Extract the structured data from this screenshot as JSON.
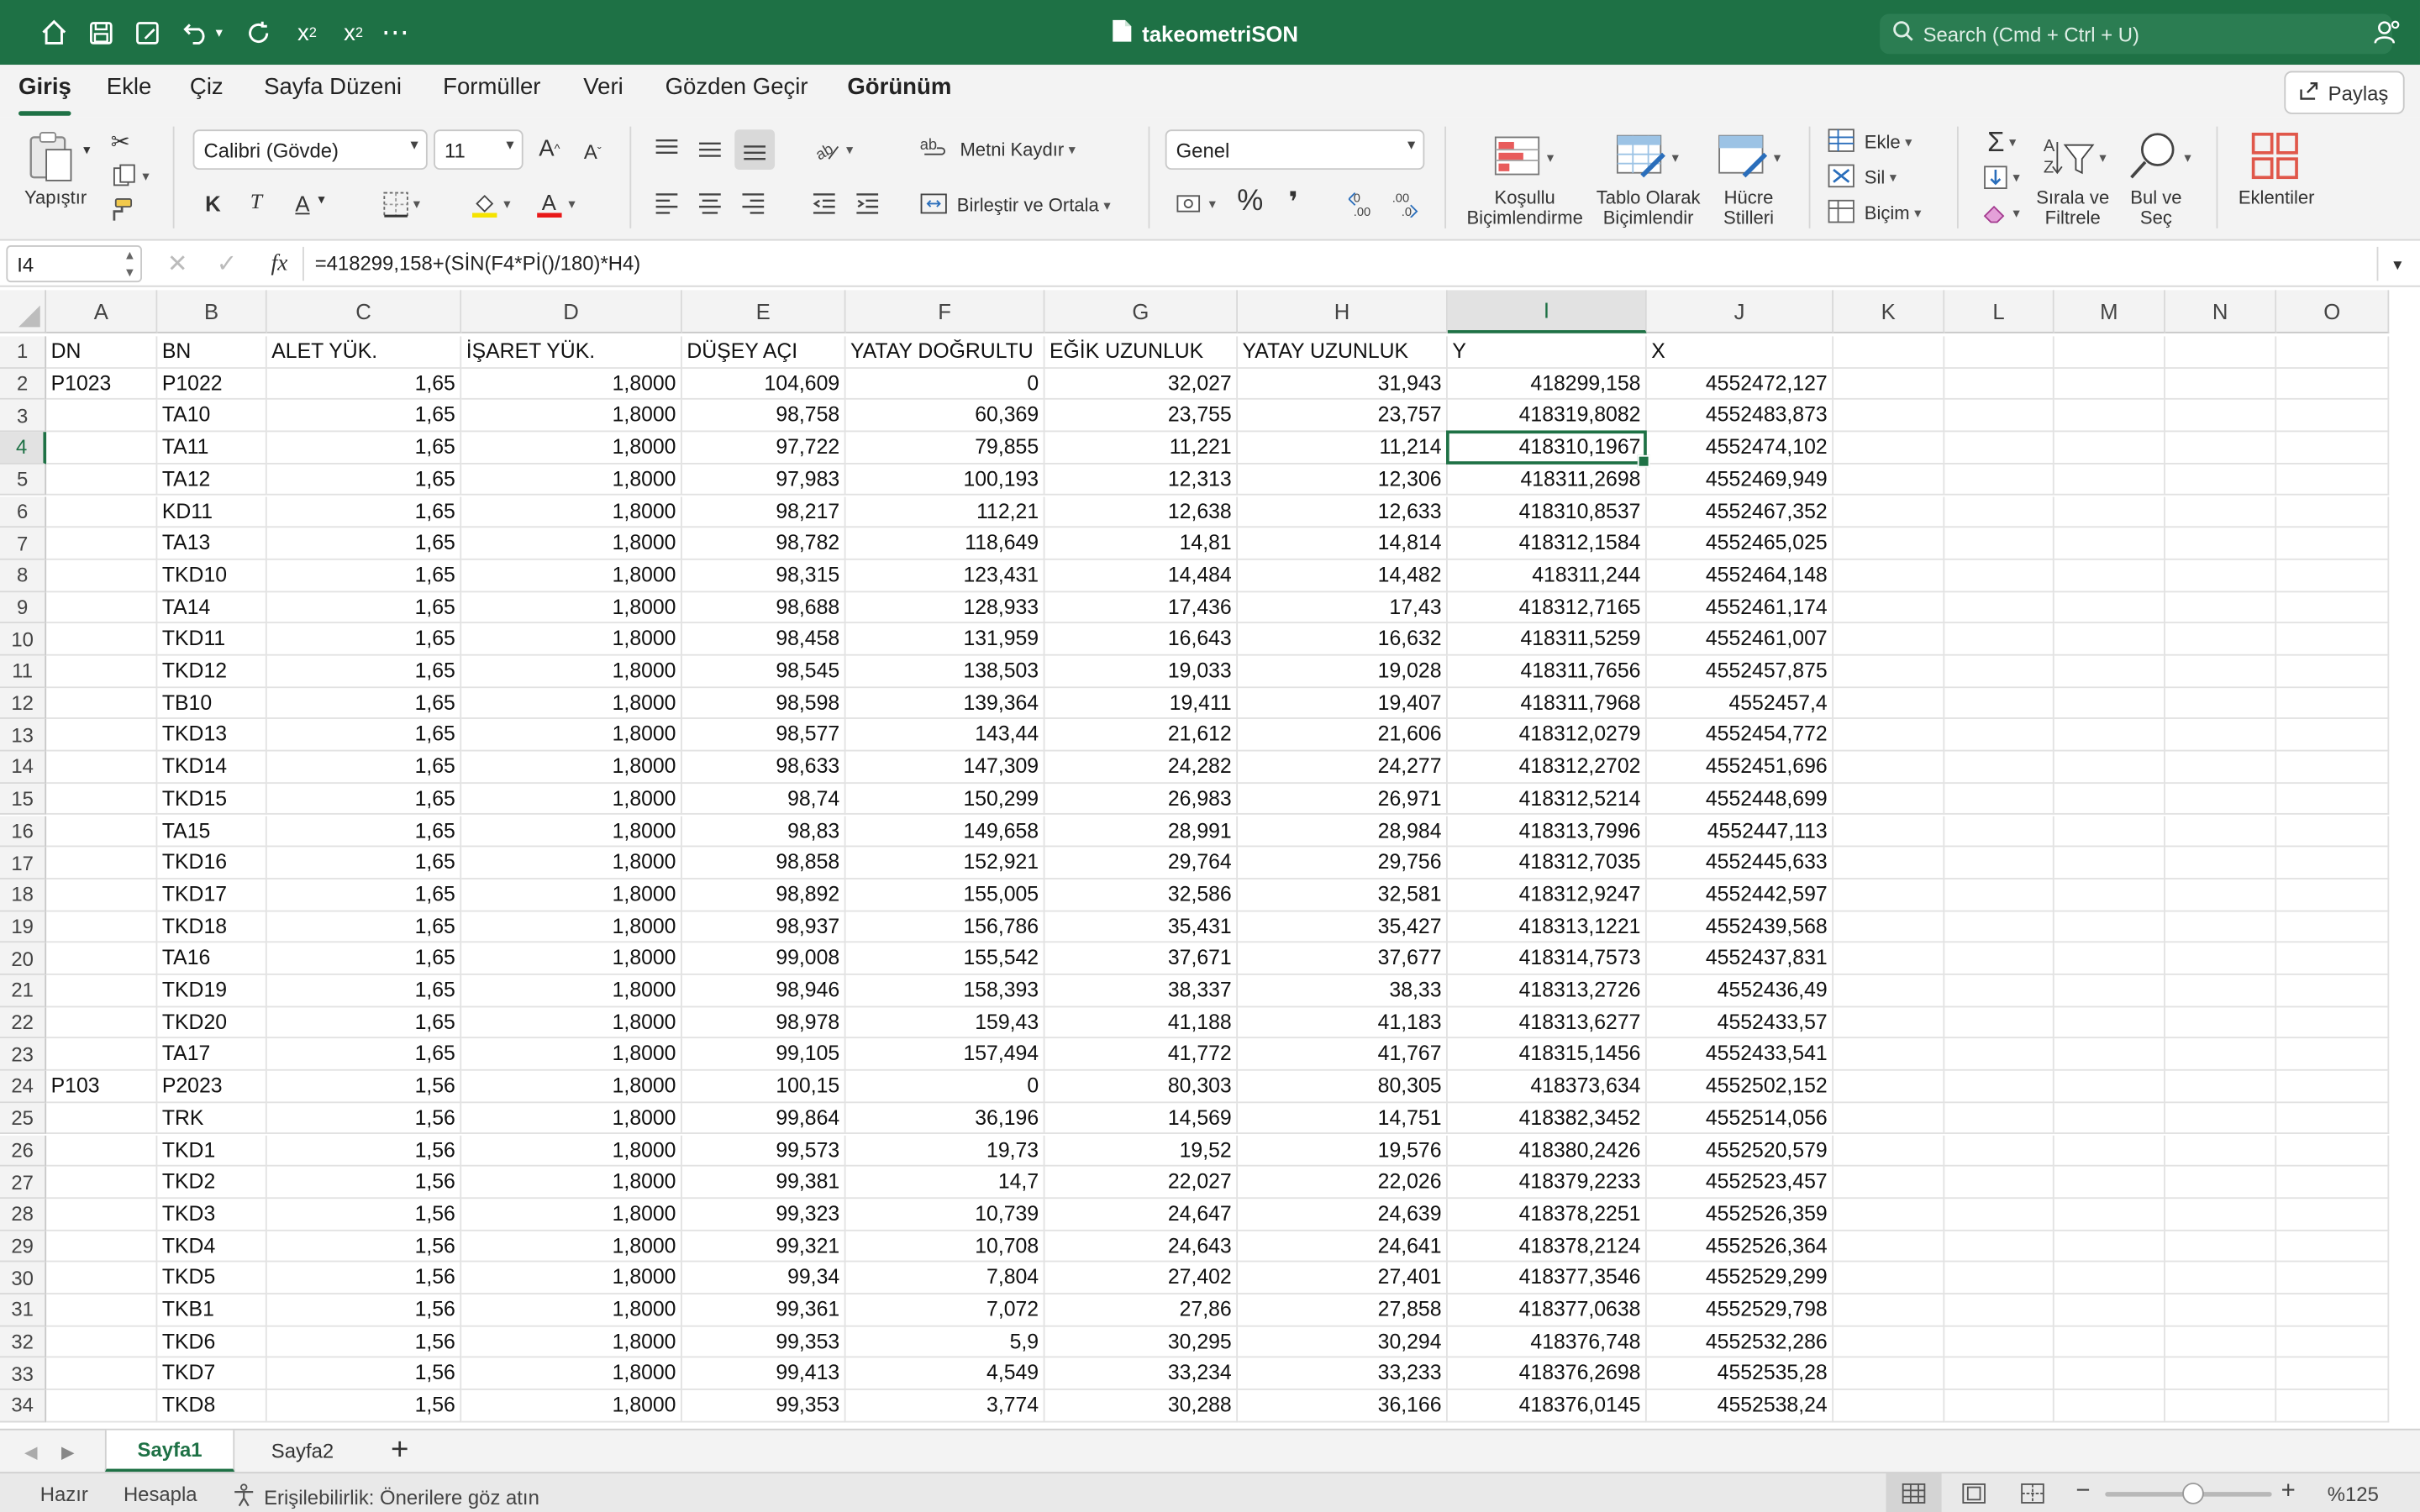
{
  "titlebar": {
    "title": "takeometriSON",
    "search_placeholder": "Search (Cmd + Ctrl + U)"
  },
  "ribbon_tabs": [
    "Giriş",
    "Ekle",
    "Çiz",
    "Sayfa Düzeni",
    "Formüller",
    "Veri",
    "Gözden Geçir",
    "Görünüm"
  ],
  "share_label": "Paylaş",
  "ribbon": {
    "paste_label": "Yapıştır",
    "font_name": "Calibri (Gövde)",
    "font_size": "11",
    "bold": "K",
    "italic": "T",
    "underline": "A",
    "wrap_text": "Metni Kaydır",
    "merge_center": "Birleştir ve Ortala",
    "number_format": "Genel",
    "cond_format": [
      "Koşullu",
      "Biçimlendirme"
    ],
    "format_table": [
      "Tablo Olarak",
      "Biçimlendir"
    ],
    "cell_styles": [
      "Hücre",
      "Stilleri"
    ],
    "insert": "Ekle",
    "delete": "Sil",
    "format": "Biçim",
    "sort_filter": [
      "Sırala ve",
      "Filtrele"
    ],
    "find_select": [
      "Bul ve",
      "Seç"
    ],
    "addins": "Eklentiler",
    "percent": "%",
    "comma": "❜"
  },
  "formula_bar": {
    "name_box": "I4",
    "fx": "fx",
    "formula": "=418299,158+(SİN(F4*Pİ()/180)*H4)"
  },
  "columns": [
    "A",
    "B",
    "C",
    "D",
    "E",
    "F",
    "G",
    "H",
    "I",
    "J",
    "K",
    "L",
    "M",
    "N",
    "O"
  ],
  "selected_cell": {
    "col": "I",
    "row": 4
  },
  "rows": [
    [
      "DN",
      "BN",
      "ALET YÜK.",
      "İŞARET YÜK.",
      "DÜŞEY AÇI",
      "YATAY DOĞRULTU",
      "EĞİK UZUNLUK",
      "YATAY UZUNLUK",
      "Y",
      "X"
    ],
    [
      "P1023",
      "P1022",
      "1,65",
      "1,8000",
      "104,609",
      "0",
      "32,027",
      "31,943",
      "418299,158",
      "4552472,127"
    ],
    [
      "",
      "TA10",
      "1,65",
      "1,8000",
      "98,758",
      "60,369",
      "23,755",
      "23,757",
      "418319,8082",
      "4552483,873"
    ],
    [
      "",
      "TA11",
      "1,65",
      "1,8000",
      "97,722",
      "79,855",
      "11,221",
      "11,214",
      "418310,1967",
      "4552474,102"
    ],
    [
      "",
      "TA12",
      "1,65",
      "1,8000",
      "97,983",
      "100,193",
      "12,313",
      "12,306",
      "418311,2698",
      "4552469,949"
    ],
    [
      "",
      "KD11",
      "1,65",
      "1,8000",
      "98,217",
      "112,21",
      "12,638",
      "12,633",
      "418310,8537",
      "4552467,352"
    ],
    [
      "",
      "TA13",
      "1,65",
      "1,8000",
      "98,782",
      "118,649",
      "14,81",
      "14,814",
      "418312,1584",
      "4552465,025"
    ],
    [
      "",
      "TKD10",
      "1,65",
      "1,8000",
      "98,315",
      "123,431",
      "14,484",
      "14,482",
      "418311,244",
      "4552464,148"
    ],
    [
      "",
      "TA14",
      "1,65",
      "1,8000",
      "98,688",
      "128,933",
      "17,436",
      "17,43",
      "418312,7165",
      "4552461,174"
    ],
    [
      "",
      "TKD11",
      "1,65",
      "1,8000",
      "98,458",
      "131,959",
      "16,643",
      "16,632",
      "418311,5259",
      "4552461,007"
    ],
    [
      "",
      "TKD12",
      "1,65",
      "1,8000",
      "98,545",
      "138,503",
      "19,033",
      "19,028",
      "418311,7656",
      "4552457,875"
    ],
    [
      "",
      "TB10",
      "1,65",
      "1,8000",
      "98,598",
      "139,364",
      "19,411",
      "19,407",
      "418311,7968",
      "4552457,4"
    ],
    [
      "",
      "TKD13",
      "1,65",
      "1,8000",
      "98,577",
      "143,44",
      "21,612",
      "21,606",
      "418312,0279",
      "4552454,772"
    ],
    [
      "",
      "TKD14",
      "1,65",
      "1,8000",
      "98,633",
      "147,309",
      "24,282",
      "24,277",
      "418312,2702",
      "4552451,696"
    ],
    [
      "",
      "TKD15",
      "1,65",
      "1,8000",
      "98,74",
      "150,299",
      "26,983",
      "26,971",
      "418312,5214",
      "4552448,699"
    ],
    [
      "",
      "TA15",
      "1,65",
      "1,8000",
      "98,83",
      "149,658",
      "28,991",
      "28,984",
      "418313,7996",
      "4552447,113"
    ],
    [
      "",
      "TKD16",
      "1,65",
      "1,8000",
      "98,858",
      "152,921",
      "29,764",
      "29,756",
      "418312,7035",
      "4552445,633"
    ],
    [
      "",
      "TKD17",
      "1,65",
      "1,8000",
      "98,892",
      "155,005",
      "32,586",
      "32,581",
      "418312,9247",
      "4552442,597"
    ],
    [
      "",
      "TKD18",
      "1,65",
      "1,8000",
      "98,937",
      "156,786",
      "35,431",
      "35,427",
      "418313,1221",
      "4552439,568"
    ],
    [
      "",
      "TA16",
      "1,65",
      "1,8000",
      "99,008",
      "155,542",
      "37,671",
      "37,677",
      "418314,7573",
      "4552437,831"
    ],
    [
      "",
      "TKD19",
      "1,65",
      "1,8000",
      "98,946",
      "158,393",
      "38,337",
      "38,33",
      "418313,2726",
      "4552436,49"
    ],
    [
      "",
      "TKD20",
      "1,65",
      "1,8000",
      "98,978",
      "159,43",
      "41,188",
      "41,183",
      "418313,6277",
      "4552433,57"
    ],
    [
      "",
      "TA17",
      "1,65",
      "1,8000",
      "99,105",
      "157,494",
      "41,772",
      "41,767",
      "418315,1456",
      "4552433,541"
    ],
    [
      "P103",
      "P2023",
      "1,56",
      "1,8000",
      "100,15",
      "0",
      "80,303",
      "80,305",
      "418373,634",
      "4552502,152"
    ],
    [
      "",
      "TRK",
      "1,56",
      "1,8000",
      "99,864",
      "36,196",
      "14,569",
      "14,751",
      "418382,3452",
      "4552514,056"
    ],
    [
      "",
      "TKD1",
      "1,56",
      "1,8000",
      "99,573",
      "19,73",
      "19,52",
      "19,576",
      "418380,2426",
      "4552520,579"
    ],
    [
      "",
      "TKD2",
      "1,56",
      "1,8000",
      "99,381",
      "14,7",
      "22,027",
      "22,026",
      "418379,2233",
      "4552523,457"
    ],
    [
      "",
      "TKD3",
      "1,56",
      "1,8000",
      "99,323",
      "10,739",
      "24,647",
      "24,639",
      "418378,2251",
      "4552526,359"
    ],
    [
      "",
      "TKD4",
      "1,56",
      "1,8000",
      "99,321",
      "10,708",
      "24,643",
      "24,641",
      "418378,2124",
      "4552526,364"
    ],
    [
      "",
      "TKD5",
      "1,56",
      "1,8000",
      "99,34",
      "7,804",
      "27,402",
      "27,401",
      "418377,3546",
      "4552529,299"
    ],
    [
      "",
      "TKB1",
      "1,56",
      "1,8000",
      "99,361",
      "7,072",
      "27,86",
      "27,858",
      "418377,0638",
      "4552529,798"
    ],
    [
      "",
      "TKD6",
      "1,56",
      "1,8000",
      "99,353",
      "5,9",
      "30,295",
      "30,294",
      "418376,748",
      "4552532,286"
    ],
    [
      "",
      "TKD7",
      "1,56",
      "1,8000",
      "99,413",
      "4,549",
      "33,234",
      "33,233",
      "418376,2698",
      "4552535,28"
    ],
    [
      "",
      "TKD8",
      "1,56",
      "1,8000",
      "99,353",
      "3,774",
      "30,288",
      "36,166",
      "418376,0145",
      "4552538,24"
    ]
  ],
  "sheets": [
    "Sayfa1",
    "Sayfa2"
  ],
  "active_sheet": "Sayfa1",
  "status": {
    "ready": "Hazır",
    "calculate": "Hesapla",
    "accessibility": "Erişilebilirlik: Önerilere göz atın",
    "zoom": "%125"
  },
  "colors": {
    "accent": "#1e7145",
    "ribbon_bg": "#f3f3f3"
  }
}
